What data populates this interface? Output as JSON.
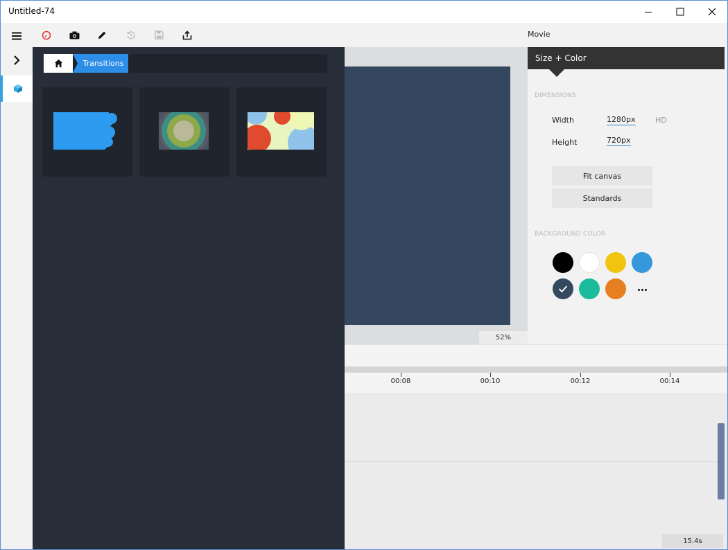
{
  "window": {
    "title": "Untitled-74"
  },
  "titlebar": {
    "minimize_icon": "minimize-icon",
    "maximize_icon": "maximize-icon",
    "close_icon": "close-icon"
  },
  "rail": {
    "menu_icon": "hamburger-icon",
    "expand_icon": "chevron-right-icon",
    "library_icon": "cube-icon"
  },
  "toolbar": {
    "icons": [
      "stopwatch-icon",
      "camera-icon",
      "pencil-icon",
      "history-icon",
      "save-icon",
      "export-icon"
    ],
    "movie_label": "Movie"
  },
  "stage": {
    "zoom": "52%"
  },
  "panel": {
    "header": "Size + Color",
    "dimensions_label": "DIMENSIONS",
    "width_label": "Width",
    "width_value": "1280px",
    "hd_tag": "HD",
    "height_label": "Height",
    "height_value": "720px",
    "fit_canvas": "Fit canvas",
    "standards": "Standards",
    "background_label": "BACKGROUND COLOR",
    "swatches": [
      "#000000",
      "#ffffff",
      "#f1c40f",
      "#3498db",
      "#34495e",
      "#1abc9c",
      "#e67e22"
    ],
    "selected_swatch": "#34495e"
  },
  "timeline": {
    "ticks": [
      "00:08",
      "00:10",
      "00:12",
      "00:14"
    ],
    "duration": "15.4s"
  },
  "library": {
    "home_icon": "home-icon",
    "breadcrumb": "Transitions",
    "tiles": [
      "transition-splash",
      "transition-rings",
      "transition-circles"
    ]
  },
  "colors": {
    "accent": "#2d8ee8",
    "stage": "#35475e",
    "library_bg": "#282e39",
    "stopwatch": "#e53935"
  }
}
